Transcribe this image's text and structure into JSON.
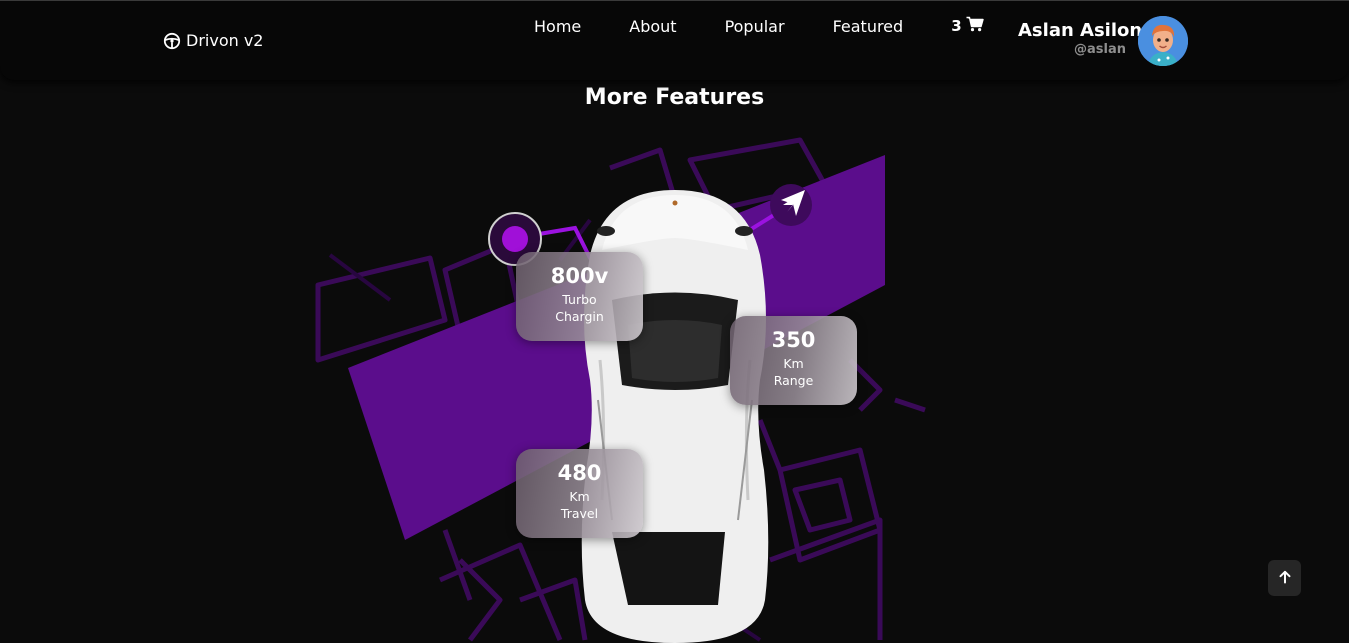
{
  "brand": {
    "name": "Drivon v2",
    "icon": "steering-wheel-icon"
  },
  "nav": {
    "items": [
      {
        "label": "Home"
      },
      {
        "label": "About"
      },
      {
        "label": "Popular"
      },
      {
        "label": "Featured"
      }
    ],
    "cart_count": "3",
    "cart_icon": "cart-icon"
  },
  "user": {
    "name": "Aslan Asilon",
    "handle": "@aslan",
    "avatar_icon": "avatar"
  },
  "section": {
    "title": "More Features"
  },
  "stats": [
    {
      "value": "800v",
      "line1": "Turbo",
      "line2": "Chargin"
    },
    {
      "value": "350",
      "line1": "Km",
      "line2": "Range"
    },
    {
      "value": "480",
      "line1": "Km",
      "line2": "Travel"
    }
  ],
  "colors": {
    "background": "#0b0b0b",
    "accent_purple": "#7a0fbf",
    "header": "#070707"
  },
  "scroll_top_icon": "arrow-up-icon"
}
